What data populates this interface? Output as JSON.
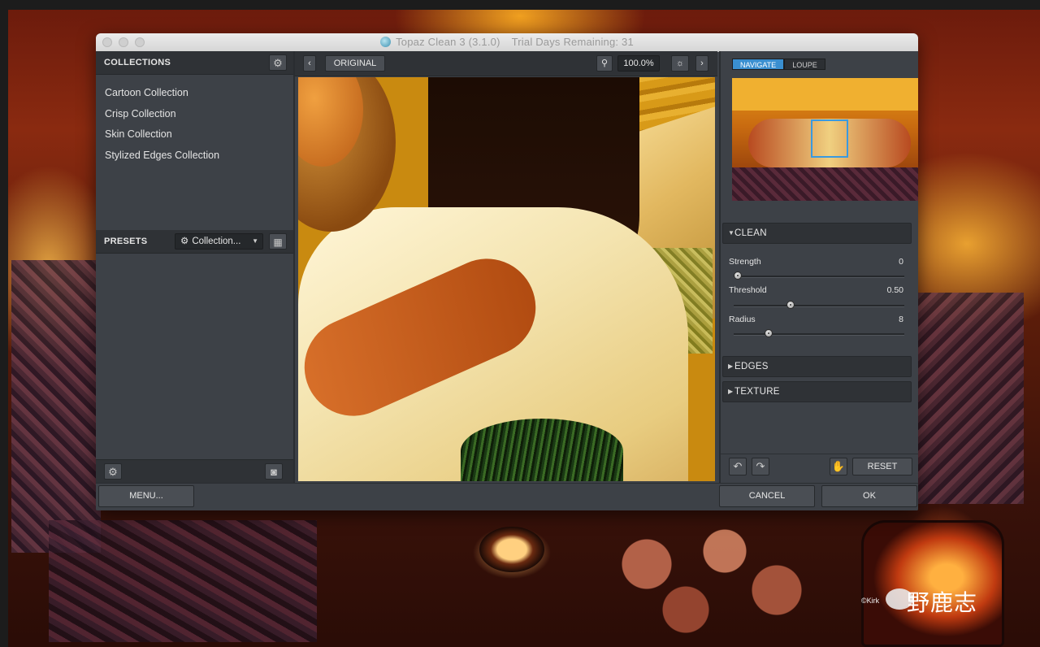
{
  "window": {
    "title": "Topaz Clean 3 (3.1.0)",
    "trial": "Trial Days Remaining: 31"
  },
  "collections": {
    "header": "COLLECTIONS",
    "items": [
      "Cartoon Collection",
      "Crisp Collection",
      "Skin Collection",
      "Stylized Edges Collection"
    ]
  },
  "presets": {
    "header": "PRESETS",
    "dropdown_value": "Collection..."
  },
  "preview_toolbar": {
    "original_label": "ORIGINAL",
    "zoom": "100.0%"
  },
  "navigator": {
    "tabs": [
      {
        "label": "NAVIGATE",
        "active": true
      },
      {
        "label": "LOUPE",
        "active": false
      }
    ]
  },
  "sections": {
    "clean": {
      "label": "CLEAN",
      "expanded": true,
      "sliders": [
        {
          "label": "Strength",
          "value": "0",
          "position": 0.0
        },
        {
          "label": "Threshold",
          "value": "0.50",
          "position": 0.33
        },
        {
          "label": "Radius",
          "value": "8",
          "position": 0.2
        }
      ]
    },
    "edges": {
      "label": "EDGES",
      "expanded": false
    },
    "texture": {
      "label": "TEXTURE",
      "expanded": false
    }
  },
  "actions": {
    "reset": "RESET",
    "menu": "MENU...",
    "cancel": "CANCEL",
    "ok": "OK"
  },
  "icons": {
    "gear": "gear-icon",
    "grid": "grid-icon",
    "camera": "camera-icon",
    "search": "search-icon",
    "brightness": "brightness-icon",
    "undo": "undo-icon",
    "redo": "redo-icon",
    "stamp": "stamp-icon"
  },
  "colors": {
    "accent": "#3a8fd0",
    "panel": "#3d4147",
    "panel_dark": "#2f3236"
  },
  "watermark": {
    "credit": "©Kirk",
    "brand": "野鹿志"
  }
}
